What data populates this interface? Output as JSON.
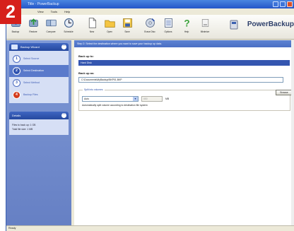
{
  "badge": "2",
  "window_title": "Title - PowerBackup",
  "menu": [
    "View",
    "Tools",
    "Help"
  ],
  "toolbar": {
    "items": [
      {
        "label": "Backup",
        "icon": "backup-icon"
      },
      {
        "label": "Restore",
        "icon": "restore-icon"
      },
      {
        "label": "Compare",
        "icon": "compare-icon"
      },
      {
        "label": "Schedule",
        "icon": "schedule-icon"
      },
      {
        "label": "New",
        "icon": "new-icon"
      },
      {
        "label": "Open",
        "icon": "open-icon"
      },
      {
        "label": "Save",
        "icon": "save-icon"
      },
      {
        "label": "Erase Disc",
        "icon": "erase-disc-icon"
      },
      {
        "label": "Options",
        "icon": "options-icon"
      },
      {
        "label": "Help",
        "icon": "help-icon"
      },
      {
        "label": "Minimize",
        "icon": "minimize-icon"
      }
    ],
    "brand": "PowerBackup"
  },
  "sidebar": {
    "panel_title": "Backup Wizard",
    "steps": [
      {
        "num": "1",
        "label": "Select Source"
      },
      {
        "num": "2",
        "label": "Select Destination"
      },
      {
        "num": "3",
        "label": "Select Method"
      },
      {
        "num": "4",
        "label": "Backup Files"
      }
    ],
    "active_step": 1,
    "details_title": "Details",
    "details": [
      "Files to back up: 1 GB",
      "Total file size: 1 MB"
    ]
  },
  "content": {
    "info_text": "Step 2: Select the destination where you want to save your backup up data.",
    "back_up_to_label": "Back up to:",
    "back_up_to_value": "Hard Disk",
    "back_up_as_label": "Back up as:",
    "back_up_as_value": "C:\\Documents\\MyBackup\\BKP01.BKP",
    "browse_label": "Browse",
    "split_legend": "Split into volumes",
    "split_mode": "Auto",
    "split_size": "650",
    "split_unit": "MB",
    "auto_split_text": "Automatically split volume according to destination file system"
  },
  "status": "Ready",
  "colors": {
    "badge": "#d6201b",
    "title_bar": "#2456c8",
    "sidebar": "#7f99d6",
    "selected_field": "#3456b0"
  }
}
